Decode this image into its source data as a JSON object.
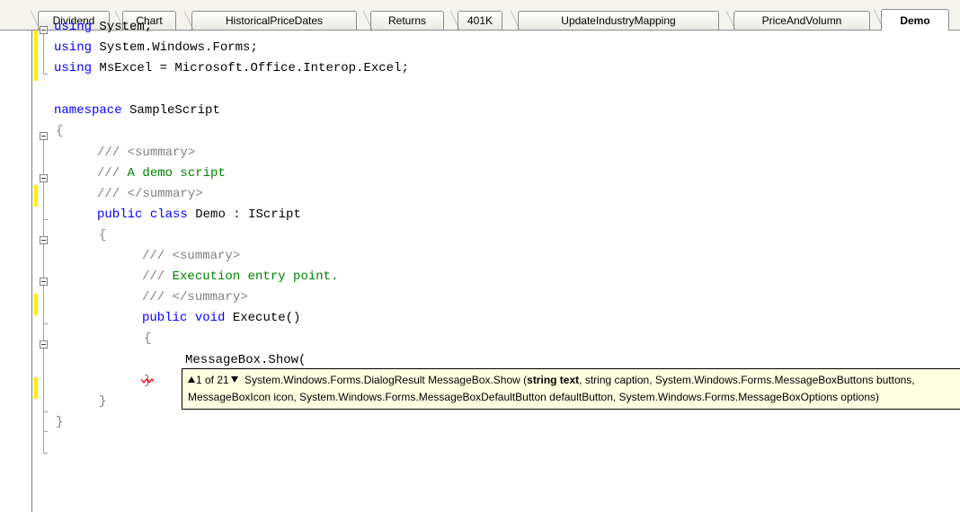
{
  "tabs": [
    {
      "label": "Dividend",
      "active": false
    },
    {
      "label": "Chart",
      "active": false
    },
    {
      "label": "HistoricalPriceDates",
      "active": false
    },
    {
      "label": "Returns",
      "active": false
    },
    {
      "label": "401K",
      "active": false
    },
    {
      "label": "UpdateIndustryMapping",
      "active": false
    },
    {
      "label": "PriceAndVolumn",
      "active": false
    },
    {
      "label": "Demo",
      "active": true
    }
  ],
  "code": {
    "using1_kw": "using",
    "using1_rest": " System;",
    "using2_kw": "using",
    "using2_rest": " System.Windows.Forms;",
    "using3_kw": "using",
    "using3_rest": " MsExcel = Microsoft.Office.Interop.Excel;",
    "ns_kw": "namespace",
    "ns_rest": " SampleScript",
    "brace_open": "{",
    "brace_close": "}",
    "doc_prefix": "///",
    "summary_open": " <summary>",
    "summary_close": " </summary>",
    "class_summary": " A demo script",
    "class_public": "public",
    "class_kw": "class",
    "class_rest": " Demo : IScript",
    "method_summary": " Execution entry point.",
    "method_public": "public",
    "method_void": "void",
    "method_rest": " Execute()",
    "call_text": "MessageBox.Show("
  },
  "tooltip": {
    "counter": "1 of 21",
    "sig_prefix": " System.Windows.Forms.DialogResult MessageBox.Show (",
    "current_param": "string text",
    "sig_rest": ", string caption, System.Windows.Forms.MessageBoxButtons buttons,",
    "line2": "MessageBoxIcon icon, System.Windows.Forms.MessageBoxDefaultButton defaultButton, System.Windows.Forms.MessageBoxOptions options)"
  },
  "colors": {
    "keyword": "#0000ff",
    "comment": "#008000",
    "doc_tag": "#808080",
    "changed_line_marker": "#ffee00",
    "tooltip_bg": "#ffffe1",
    "error_squiggle": "#ff0000"
  }
}
